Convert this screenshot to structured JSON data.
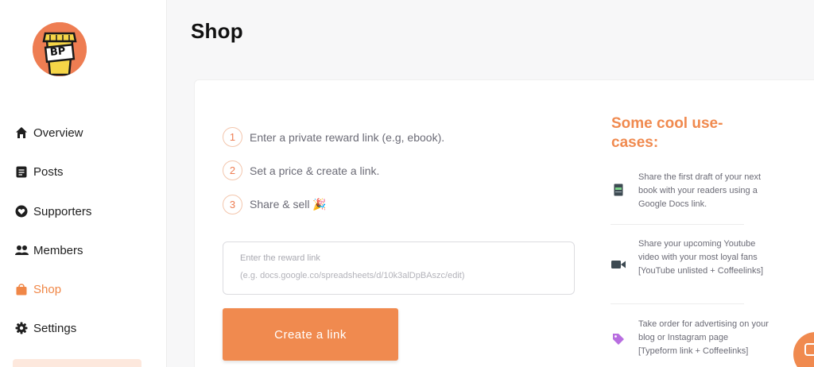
{
  "sidebar": {
    "logo_text": "BP",
    "items": [
      {
        "label": "Overview",
        "icon": "home-icon"
      },
      {
        "label": "Posts",
        "icon": "posts-icon"
      },
      {
        "label": "Supporters",
        "icon": "heart-icon"
      },
      {
        "label": "Members",
        "icon": "members-icon"
      },
      {
        "label": "Shop",
        "icon": "shop-bag-icon",
        "active": true
      },
      {
        "label": "Settings",
        "icon": "gear-icon"
      }
    ]
  },
  "header": {
    "title": "Shop"
  },
  "steps": [
    {
      "num": "1",
      "text": "Enter a private reward link (e.g, ebook)."
    },
    {
      "num": "2",
      "text": "Set a price & create a link."
    },
    {
      "num": "3",
      "text": "Share & sell 🎉"
    }
  ],
  "reward": {
    "label": "Enter the reward link",
    "placeholder": "(e.g. docs.google.co/spreadsheets/d/10k3alDpBAszc/edit)"
  },
  "create_button": "Create a link",
  "use_cases": {
    "title": "Some cool use-cases:",
    "items": [
      {
        "icon": "book-icon",
        "text": "Share the first draft of your next book with your readers using a Google Docs link."
      },
      {
        "icon": "video-camera-icon",
        "text": "Share your upcoming Youtube video with your most loyal fans [YouTube unlisted + Coffeelinks]"
      },
      {
        "icon": "tag-icon",
        "text": "Take order for advertising on your blog or Instagram page [Typeform link + Coffeelinks]"
      }
    ]
  },
  "colors": {
    "accent": "#f08a4f",
    "active_nav": "#f08747"
  }
}
